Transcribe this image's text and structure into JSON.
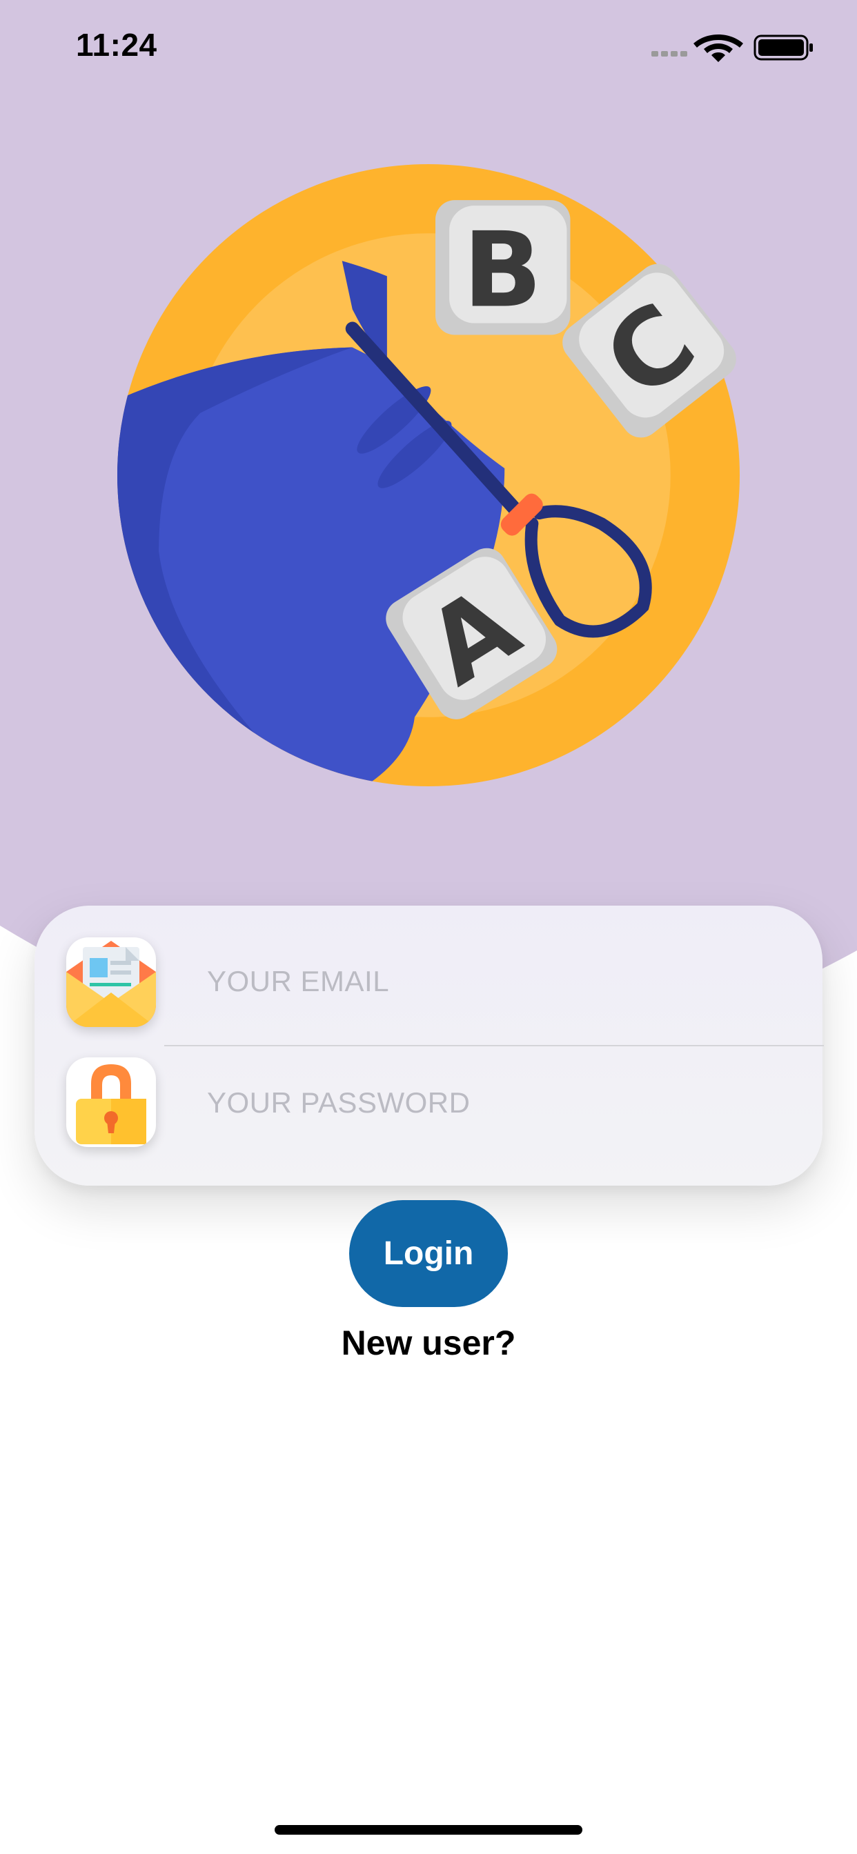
{
  "status_bar": {
    "time": "11:24",
    "icons": [
      "cellular-signal-icon",
      "wifi-icon",
      "battery-icon"
    ]
  },
  "illustration": {
    "name": "abc-bag-illustration",
    "letters": [
      "B",
      "C",
      "A"
    ]
  },
  "login_form": {
    "email": {
      "placeholder": "YOUR EMAIL",
      "value": "",
      "icon": "envelope-icon"
    },
    "password": {
      "placeholder": "YOUR PASSWORD",
      "value": "",
      "icon": "padlock-icon"
    }
  },
  "actions": {
    "login_label": "Login",
    "new_user_label": "New user?"
  },
  "colors": {
    "header_background": "#d3c5e0",
    "primary_button": "#1168a8",
    "card_background": "#f1f0f6",
    "placeholder_text": "#bbbbc3"
  }
}
